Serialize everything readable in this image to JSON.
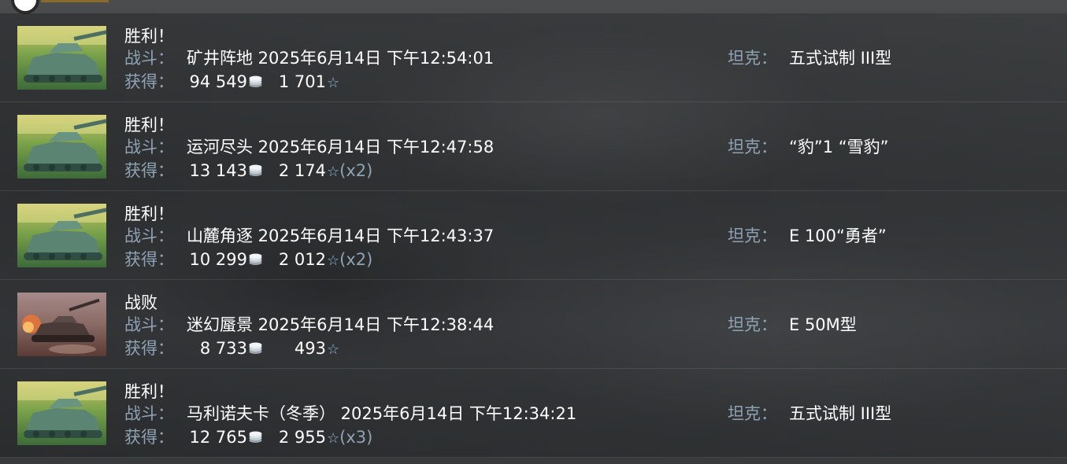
{
  "labels": {
    "battle": "战斗：",
    "earnings": "获得：",
    "tank": "坦克："
  },
  "battles": [
    {
      "result": "胜利！",
      "thumbnail": "victory",
      "battle_info": "矿井阵地 2025年6月14日 下午12:54:01",
      "credits": "94 549",
      "xp": "1 701",
      "multiplier": "",
      "tank": "五式试制 III型"
    },
    {
      "result": "胜利！",
      "thumbnail": "victory",
      "battle_info": "运河尽头 2025年6月14日 下午12:47:58",
      "credits": "13 143",
      "xp": "2 174",
      "multiplier": "(x2)",
      "tank": "“豹”1 “雪豹”"
    },
    {
      "result": "胜利！",
      "thumbnail": "victory",
      "battle_info": "山麓角逐 2025年6月14日 下午12:43:37",
      "credits": "10 299",
      "xp": "2 012",
      "multiplier": "(x2)",
      "tank": "E 100“勇者”"
    },
    {
      "result": "战败",
      "thumbnail": "defeat",
      "battle_info": "迷幻蜃景 2025年6月14日 下午12:38:44",
      "credits": "8 733",
      "xp": "493",
      "multiplier": "",
      "tank": "E 50M型"
    },
    {
      "result": "胜利！",
      "thumbnail": "victory",
      "battle_info": "马利诺夫卡（冬季） 2025年6月14日 下午12:34:21",
      "credits": "12 765",
      "xp": "2 955",
      "multiplier": "(x3)",
      "tank": "五式试制 III型"
    }
  ],
  "icons": {
    "credits": "coins-icon",
    "xp": "star-icon"
  },
  "colors": {
    "label": "#8fa3b5",
    "text": "#ffffff",
    "star": "#8fb4d8"
  }
}
